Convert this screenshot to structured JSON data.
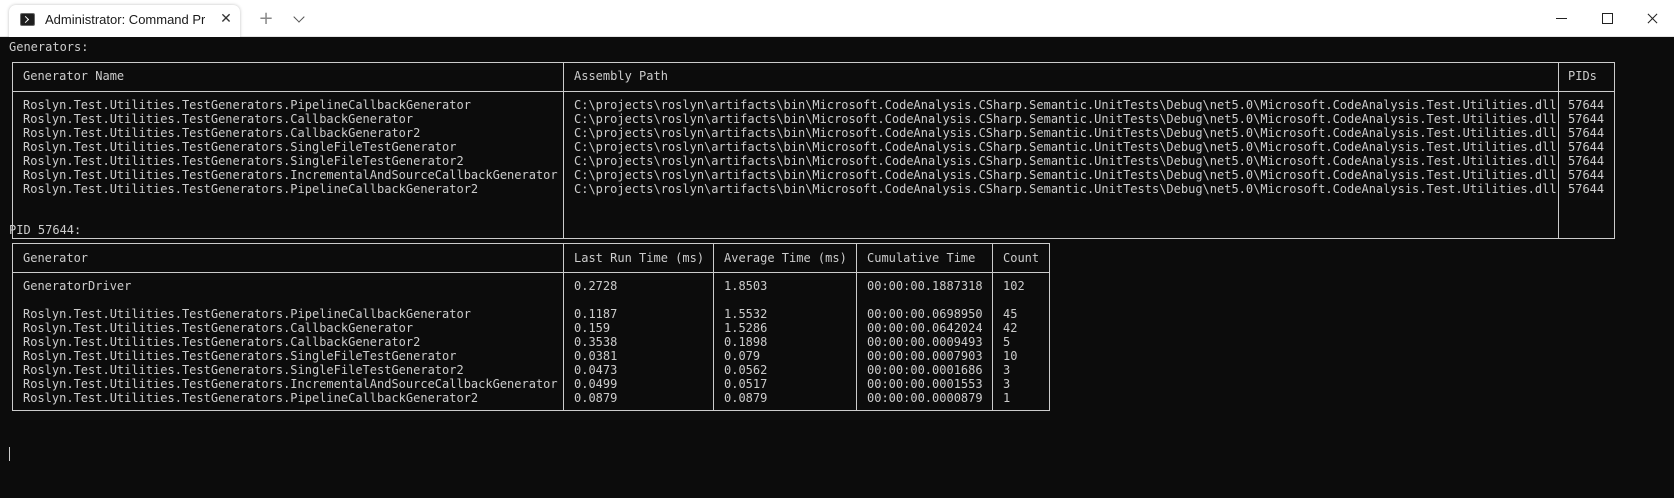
{
  "window": {
    "tab_title": "Administrator: Command Prompt",
    "tab_icon": "terminal-icon",
    "new_tab": "+",
    "tab_close": "✕"
  },
  "terminal": {
    "generators_heading": "Generators:",
    "generators_table": {
      "headers": [
        "Generator Name",
        "Assembly Path",
        "PIDs"
      ],
      "rows": [
        [
          "Roslyn.Test.Utilities.TestGenerators.PipelineCallbackGenerator",
          "C:\\projects\\roslyn\\artifacts\\bin\\Microsoft.CodeAnalysis.CSharp.Semantic.UnitTests\\Debug\\net5.0\\Microsoft.CodeAnalysis.Test.Utilities.dll",
          "57644"
        ],
        [
          "Roslyn.Test.Utilities.TestGenerators.CallbackGenerator",
          "C:\\projects\\roslyn\\artifacts\\bin\\Microsoft.CodeAnalysis.CSharp.Semantic.UnitTests\\Debug\\net5.0\\Microsoft.CodeAnalysis.Test.Utilities.dll",
          "57644"
        ],
        [
          "Roslyn.Test.Utilities.TestGenerators.CallbackGenerator2",
          "C:\\projects\\roslyn\\artifacts\\bin\\Microsoft.CodeAnalysis.CSharp.Semantic.UnitTests\\Debug\\net5.0\\Microsoft.CodeAnalysis.Test.Utilities.dll",
          "57644"
        ],
        [
          "Roslyn.Test.Utilities.TestGenerators.SingleFileTestGenerator",
          "C:\\projects\\roslyn\\artifacts\\bin\\Microsoft.CodeAnalysis.CSharp.Semantic.UnitTests\\Debug\\net5.0\\Microsoft.CodeAnalysis.Test.Utilities.dll",
          "57644"
        ],
        [
          "Roslyn.Test.Utilities.TestGenerators.SingleFileTestGenerator2",
          "C:\\projects\\roslyn\\artifacts\\bin\\Microsoft.CodeAnalysis.CSharp.Semantic.UnitTests\\Debug\\net5.0\\Microsoft.CodeAnalysis.Test.Utilities.dll",
          "57644"
        ],
        [
          "Roslyn.Test.Utilities.TestGenerators.IncrementalAndSourceCallbackGenerator",
          "C:\\projects\\roslyn\\artifacts\\bin\\Microsoft.CodeAnalysis.CSharp.Semantic.UnitTests\\Debug\\net5.0\\Microsoft.CodeAnalysis.Test.Utilities.dll",
          "57644"
        ],
        [
          "Roslyn.Test.Utilities.TestGenerators.PipelineCallbackGenerator2",
          "C:\\projects\\roslyn\\artifacts\\bin\\Microsoft.CodeAnalysis.CSharp.Semantic.UnitTests\\Debug\\net5.0\\Microsoft.CodeAnalysis.Test.Utilities.dll",
          "57644"
        ]
      ]
    },
    "pid_heading": "PID 57644:",
    "pid_table": {
      "headers": [
        "Generator",
        "Last Run Time (ms)",
        "Average Time (ms)",
        "Cumulative Time",
        "Count"
      ],
      "driver_row": [
        "GeneratorDriver",
        "0.2728",
        "1.8503",
        "00:00:00.1887318",
        "102"
      ],
      "rows": [
        [
          "Roslyn.Test.Utilities.TestGenerators.PipelineCallbackGenerator",
          "0.1187",
          "1.5532",
          "00:00:00.0698950",
          "45"
        ],
        [
          "Roslyn.Test.Utilities.TestGenerators.CallbackGenerator",
          "0.159",
          "1.5286",
          "00:00:00.0642024",
          "42"
        ],
        [
          "Roslyn.Test.Utilities.TestGenerators.CallbackGenerator2",
          "0.3538",
          "0.1898",
          "00:00:00.0009493",
          "5"
        ],
        [
          "Roslyn.Test.Utilities.TestGenerators.SingleFileTestGenerator",
          "0.0381",
          "0.079",
          "00:00:00.0007903",
          "10"
        ],
        [
          "Roslyn.Test.Utilities.TestGenerators.SingleFileTestGenerator2",
          "0.0473",
          "0.0562",
          "00:00:00.0001686",
          "3"
        ],
        [
          "Roslyn.Test.Utilities.TestGenerators.IncrementalAndSourceCallbackGenerator",
          "0.0499",
          "0.0517",
          "00:00:00.0001553",
          "3"
        ],
        [
          "Roslyn.Test.Utilities.TestGenerators.PipelineCallbackGenerator2",
          "0.0879",
          "0.0879",
          "00:00:00.0000879",
          "1"
        ]
      ]
    }
  }
}
